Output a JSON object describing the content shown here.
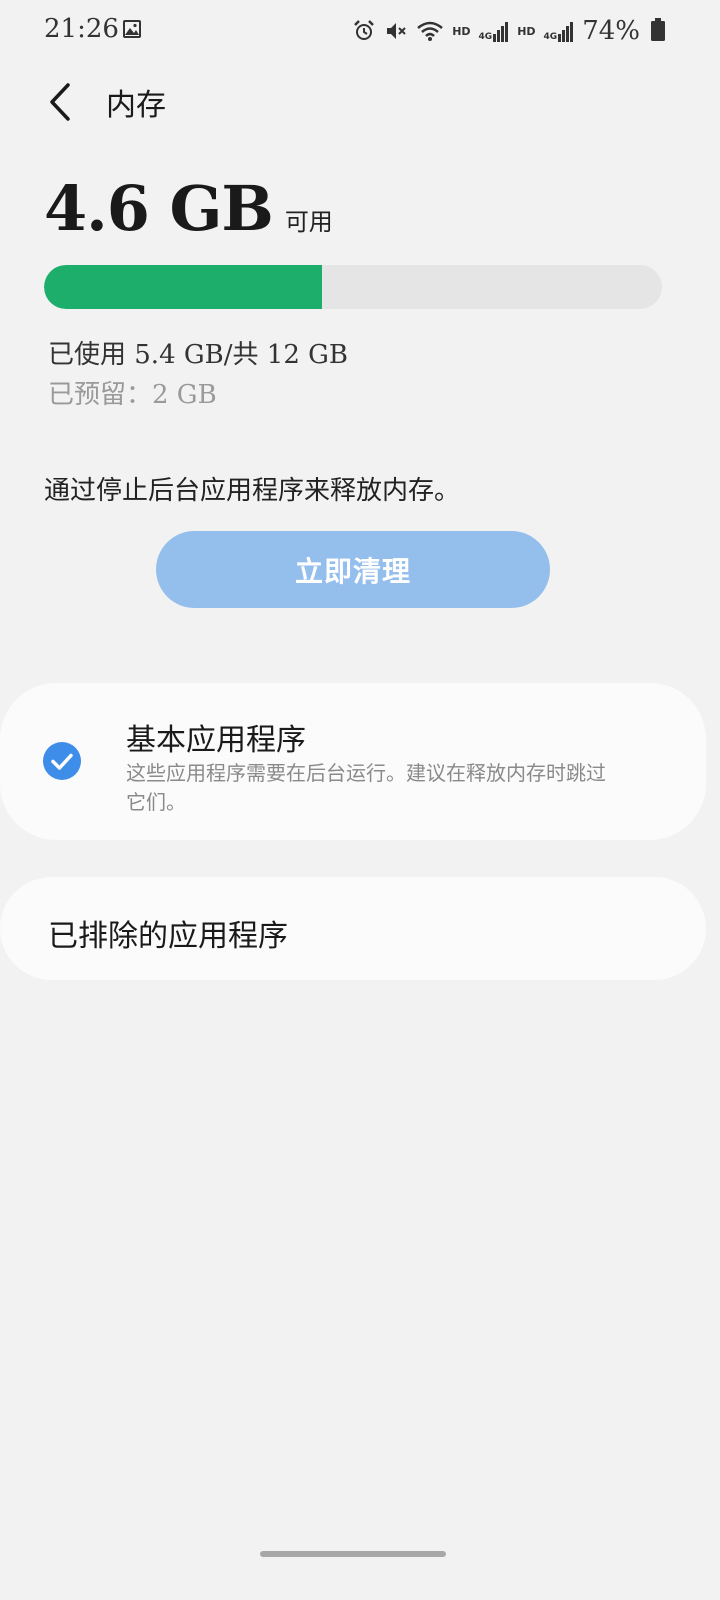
{
  "status_bar": {
    "time": "21:26",
    "hd1": "HD",
    "net1": "4G",
    "hd2": "HD",
    "net2": "4G",
    "battery": "74%",
    "icons": [
      "image-icon",
      "alarm-icon",
      "mute-icon",
      "wifi-icon",
      "signal-icon",
      "signal-icon",
      "battery-icon"
    ]
  },
  "header": {
    "title": "内存",
    "back_icon": "chevron-left-icon"
  },
  "memory": {
    "available_value": "4.6 GB",
    "available_label": "可用",
    "used_fraction": 0.45,
    "used_text": "已使用 5.4 GB/共 12 GB",
    "reserved_text": "已预留：2 GB",
    "bar_color": "#1eae6c",
    "bar_track_color": "#e5e5e5"
  },
  "hint": "通过停止后台应用程序来释放内存。",
  "clean_button": {
    "label": "立即清理",
    "color": "#94bfec"
  },
  "essential_apps": {
    "checked": true,
    "title": "基本应用程序",
    "description": "这些应用程序需要在后台运行。建议在释放内存时跳过它们。",
    "check_color": "#3e8ee9"
  },
  "excluded_apps": {
    "title": "已排除的应用程序"
  }
}
